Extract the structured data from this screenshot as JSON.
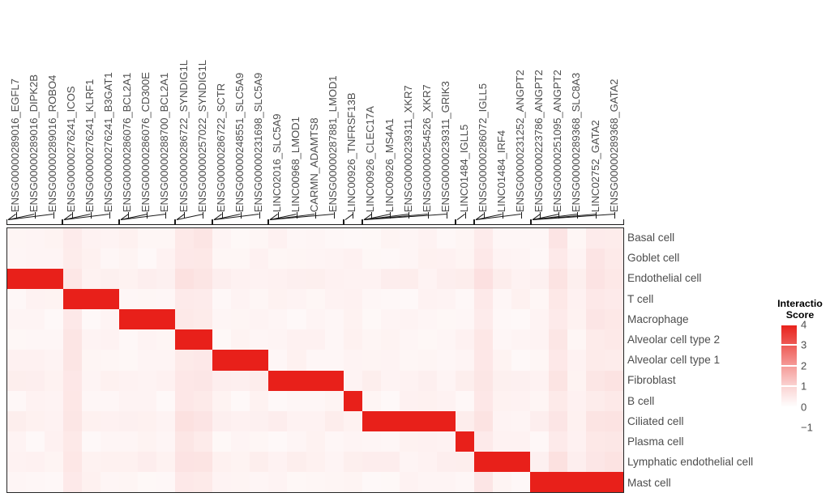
{
  "figure": {
    "type": "heatmap",
    "legend": {
      "title": "Interaction\nScore",
      "title_line1": "Interactio",
      "title_line2": "Score",
      "ticks": [
        "4",
        "3",
        "2",
        "1",
        "0",
        "-1"
      ],
      "tick_values": [
        4,
        3,
        2,
        1,
        0,
        -1
      ],
      "color_high": "#e8201a",
      "color_low": "#ffffff",
      "background_color": "#fdf1ee"
    }
  },
  "chart_data": {
    "type": "heatmap",
    "title": "",
    "xlabel": "",
    "ylabel": "",
    "legend_title": "Interaction Score",
    "legend_position": "right",
    "zlim": [
      -1,
      4
    ],
    "colormap": [
      "#ffffff",
      "#e8201a"
    ],
    "columns": [
      "ENSG00000289016_EGFL7",
      "ENSG00000289016_DIPK2B",
      "ENSG00000289016_ROBO4",
      "ENSG00000276241_ICOS",
      "ENSG00000276241_KLRF1",
      "ENSG00000276241_B3GAT1",
      "ENSG00000286076_BCL2A1",
      "ENSG00000286076_CD300E",
      "ENSG00000288700_BCL2A1",
      "ENSG00000286722_SYNDIG1L",
      "ENSG00000257022_SYNDIG1L",
      "ENSG00000286722_SCTR",
      "ENSG00000248551_SLC5A9",
      "ENSG00000231698_SLC5A9",
      "LINC02016_SLC5A9",
      "LINC00968_LMOD1",
      "CARMN_ADAMTS8",
      "ENSG00000287881_LMOD1",
      "LINC00926_TNFRSF13B",
      "LINC00926_CLEC17A",
      "LINC00926_MS4A1",
      "ENSG00000239311_XKR7",
      "ENSG00000254526_XKR7",
      "ENSG00000239311_GRIK3",
      "LINC01484_IGLL5",
      "ENSG00000286072_IGLL5",
      "LINC01484_IRF4",
      "ENSG00000231252_ANGPT2",
      "ENSG00000223786_ANGPT2",
      "ENSG00000251095_ANGPT2",
      "ENSG00000289368_SLC8A3",
      "LINC02752_GATA2",
      "ENSG00000289368_GATA2"
    ],
    "rows": [
      "Basal cell",
      "Goblet cell",
      "Endothelial cell",
      "T cell",
      "Macrophage",
      "Alveolar cell type 2",
      "Alveolar cell type 1",
      "Fibroblast",
      "B cell",
      "Ciliated cell",
      "Plasma cell",
      "Lymphatic endothelial cell",
      "Mast cell"
    ],
    "highlight_blocks": [
      {
        "row": "Endothelial cell",
        "row_index": 2,
        "col_start": 0,
        "col_end": 2,
        "value": 4
      },
      {
        "row": "T cell",
        "row_index": 3,
        "col_start": 3,
        "col_end": 5,
        "value": 4
      },
      {
        "row": "Macrophage",
        "row_index": 4,
        "col_start": 6,
        "col_end": 8,
        "value": 4
      },
      {
        "row": "Alveolar cell type 2",
        "row_index": 5,
        "col_start": 9,
        "col_end": 10,
        "value": 4
      },
      {
        "row": "Alveolar cell type 1",
        "row_index": 6,
        "col_start": 11,
        "col_end": 13,
        "value": 4
      },
      {
        "row": "Fibroblast",
        "row_index": 7,
        "col_start": 14,
        "col_end": 17,
        "value": 4
      },
      {
        "row": "B cell",
        "row_index": 8,
        "col_start": 18,
        "col_end": 18,
        "value": 4
      },
      {
        "row": "Ciliated cell",
        "row_index": 9,
        "col_start": 19,
        "col_end": 23,
        "value": 4
      },
      {
        "row": "Plasma cell",
        "row_index": 10,
        "col_start": 24,
        "col_end": 24,
        "value": 4
      },
      {
        "row": "Lymphatic endothelial cell",
        "row_index": 11,
        "col_start": 25,
        "col_end": 27,
        "value": 4
      },
      {
        "row": "Mast cell",
        "row_index": 12,
        "col_start": 28,
        "col_end": 32,
        "value": 4
      }
    ],
    "column_groups": [
      {
        "start": 0,
        "end": 2
      },
      {
        "start": 3,
        "end": 5
      },
      {
        "start": 6,
        "end": 8
      },
      {
        "start": 9,
        "end": 10
      },
      {
        "start": 11,
        "end": 13
      },
      {
        "start": 14,
        "end": 17
      },
      {
        "start": 18,
        "end": 18
      },
      {
        "start": 19,
        "end": 23
      },
      {
        "start": 24,
        "end": 24
      },
      {
        "start": 25,
        "end": 27
      },
      {
        "start": 28,
        "end": 32
      }
    ],
    "background_values": {
      "description": "Non-highlighted cells carry low interaction scores near 0, rendered as very pale pink to white vertical striping.",
      "range": [
        -1,
        0.6
      ]
    }
  }
}
